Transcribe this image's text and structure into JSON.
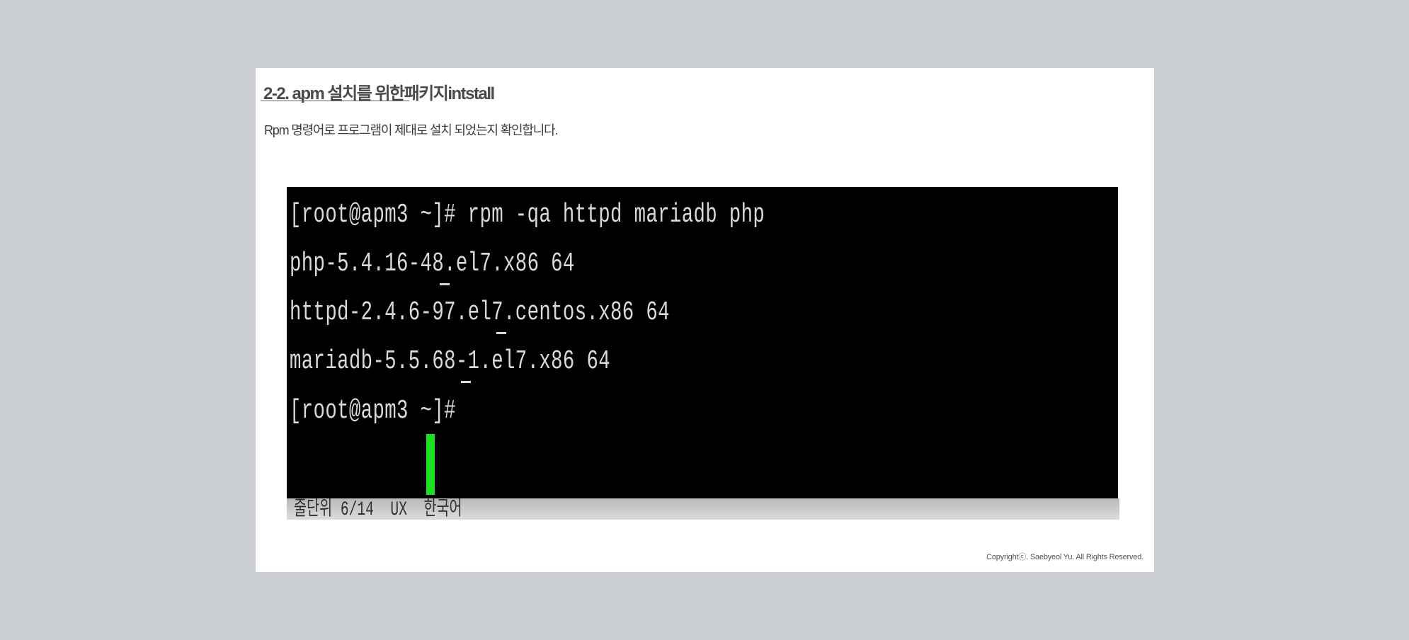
{
  "slide": {
    "title": "2-2. apm 설치를 위한패키지intstall",
    "subtitle": "Rpm 명령어로 프로그램이 제대로 설치 되었는지 확인합니다.",
    "copyright": "Copyrightⓒ. Saebyeol Yu. All Rights Reserved."
  },
  "terminal": {
    "lines": [
      "[root@apm3 ~]# rpm -qa httpd mariadb php",
      "php-5.4.16-48.el7.x86 64",
      "httpd-2.4.6-97.el7.centos.x86 64",
      "mariadb-5.5.68-1.el7.x86 64",
      "[root@apm3 ~]#"
    ],
    "cursor_color": "#1ee01e",
    "status_text": "줄단위 6/14  UX  한국어"
  },
  "colors": {
    "background": "#cbced3",
    "panel": "#ffffff",
    "terminal_bg": "#000000",
    "terminal_fg": "#d9d9d9"
  }
}
